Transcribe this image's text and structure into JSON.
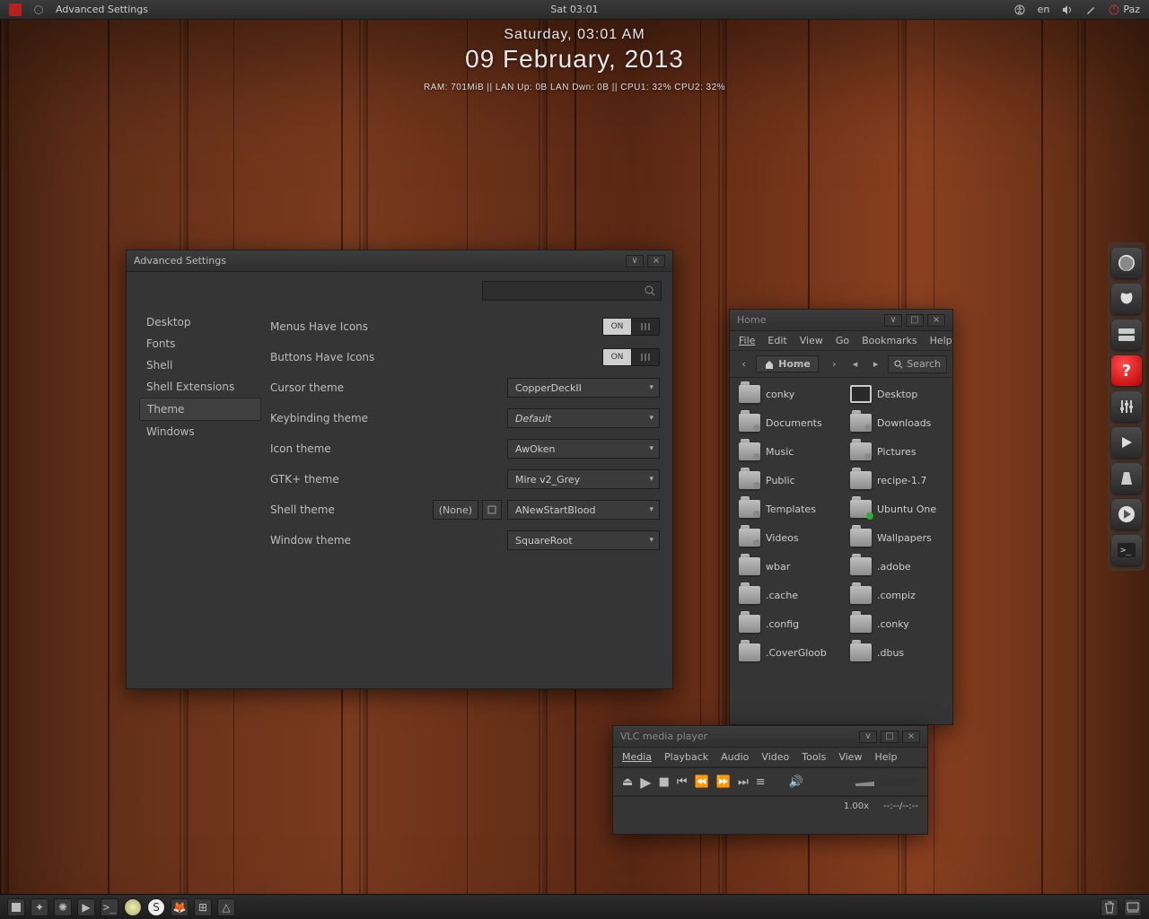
{
  "topbar": {
    "app_title": "Advanced Settings",
    "clock": "Sat 03:01",
    "lang": "en",
    "user": "Paz"
  },
  "conky": {
    "line1": "Saturday, 03:01 AM",
    "line2": "09 February, 2013",
    "line3": "RAM: 701MiB || LAN Up: 0B LAN Dwn: 0B || CPU1: 32% CPU2: 32%"
  },
  "adv_window": {
    "title": "Advanced Settings",
    "sidebar": [
      "Desktop",
      "Fonts",
      "Shell",
      "Shell Extensions",
      "Theme",
      "Windows"
    ],
    "selected_sidebar": 4,
    "rows": {
      "menus_icons": "Menus Have Icons",
      "buttons_icons": "Buttons Have Icons",
      "on": "ON",
      "cursor_label": "Cursor theme",
      "cursor_val": "CopperDeckII",
      "keybind_label": "Keybinding theme",
      "keybind_val": "Default",
      "icon_label": "Icon theme",
      "icon_val": "AwOken",
      "gtk_label": "GTK+ theme",
      "gtk_val": "Mire v2_Grey",
      "shell_label": "Shell theme",
      "shell_none": "(None)",
      "shell_val": "ANewStartBlood",
      "window_label": "Window theme",
      "window_val": "SquareRoot"
    }
  },
  "fm_window": {
    "title": "Home",
    "menus": [
      "File",
      "Edit",
      "View",
      "Go",
      "Bookmarks",
      "Help"
    ],
    "crumb": "Home",
    "search": "Search",
    "left_col": [
      "conky",
      "Documents",
      "Music",
      "Public",
      "Templates",
      "Videos",
      "wbar",
      ".cache",
      ".config",
      ".CoverGloob"
    ],
    "right_col": [
      "Desktop",
      "Downloads",
      "Pictures",
      "recipe-1.7",
      "Ubuntu One",
      "Wallpapers",
      ".adobe",
      ".compiz",
      ".conky",
      ".dbus"
    ]
  },
  "vlc_window": {
    "title": "VLC media player",
    "menus": [
      "Media",
      "Playback",
      "Audio",
      "Video",
      "Tools",
      "View",
      "Help"
    ],
    "speed": "1.00x",
    "time": "--:--/--:--"
  }
}
